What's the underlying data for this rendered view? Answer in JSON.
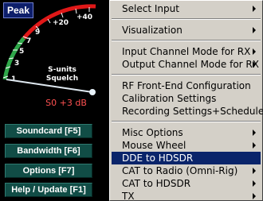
{
  "meter": {
    "peak_label": "Peak",
    "scale_labels": [
      "1",
      "3",
      "5",
      "7",
      "9",
      "+20",
      "+40"
    ],
    "title_line1": "S-units",
    "title_line2": "Squelch",
    "reading": "S0 +3 dB",
    "colors": {
      "red": "#e01818",
      "green": "#2fa84a",
      "needle": "#dfe8f0"
    }
  },
  "buttons": [
    {
      "label": "Soundcard [F5]"
    },
    {
      "label": "Bandwidth  [F6]"
    },
    {
      "label": "Options   [F7]"
    },
    {
      "label": "Help / Update  [F1]"
    }
  ],
  "menu": {
    "items": [
      {
        "label": "Select Input",
        "submenu": true
      },
      {
        "label": "Visualization",
        "submenu": true
      },
      {
        "label": "Input Channel Mode for RX",
        "submenu": true
      },
      {
        "label": "Output Channel Mode for RX",
        "submenu": true
      },
      {
        "label": "RF Front-End Configuration",
        "submenu": false
      },
      {
        "label": "Calibration Settings",
        "submenu": false
      },
      {
        "label": "Recording Settings+Scheduler",
        "submenu": false
      },
      {
        "label": "Misc Options",
        "submenu": true
      },
      {
        "label": "Mouse Wheel",
        "submenu": true
      },
      {
        "label": "DDE to HDSDR",
        "submenu": false,
        "selected": true
      },
      {
        "label": "CAT to Radio (Omni-Rig)",
        "submenu": true
      },
      {
        "label": "CAT to HDSDR",
        "submenu": true
      },
      {
        "label": "TX",
        "submenu": true
      }
    ]
  }
}
